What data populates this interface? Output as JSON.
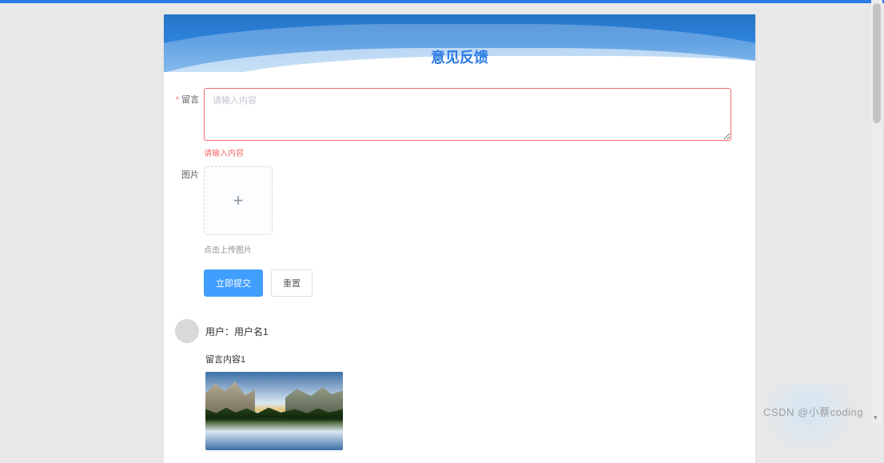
{
  "banner": {
    "title": "意见反馈"
  },
  "form": {
    "message_label": "留言",
    "message_placeholder": "请输入内容",
    "message_error": "请输入内容",
    "image_label": "图片",
    "upload_hint": "点击上传图片",
    "submit_label": "立即提交",
    "reset_label": "重置"
  },
  "comment": {
    "user_prefix": "用户：",
    "username": "用户名1",
    "content": "留言内容1"
  },
  "watermark": "CSDN @小蔡coding"
}
